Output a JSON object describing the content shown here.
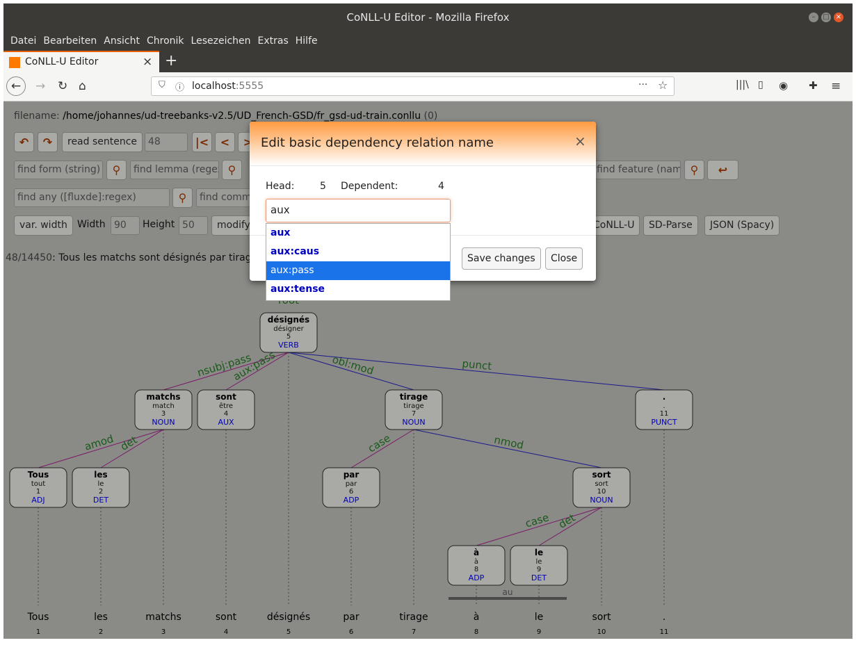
{
  "window": {
    "title": "CoNLL-U Editor - Mozilla Firefox"
  },
  "menu": [
    "Datei",
    "Bearbeiten",
    "Ansicht",
    "Chronik",
    "Lesezeichen",
    "Extras",
    "Hilfe"
  ],
  "tab": {
    "title": "CoNLL-U Editor",
    "favicon_text": "orange"
  },
  "url": {
    "host": "localhost",
    "port": ":5555"
  },
  "file": {
    "label": "filename:",
    "path": "/home/johannes/ud-treebanks-v2.5/UD_French-GSD/fr_gsd-ud-train.conllu",
    "suffix": "(0)"
  },
  "toolbar": {
    "read_sentence": "read sentence",
    "sentence_number": "48",
    "find_form": "find form (string)",
    "find_lemma": "find lemma (regex",
    "find_feature": "find feature (nam",
    "find_any": "find any ([fluxde]:regex)",
    "find_comment": "find comm",
    "var_width": "var. width",
    "width_label": "Width",
    "width_value": "90",
    "height_label": "Height",
    "height_value": "50",
    "modify": "modify",
    "conllu": "CoNLL-U",
    "sd_parse": "SD-Parse",
    "json": "JSON (Spacy)"
  },
  "sentence": {
    "counter": "48/14450",
    "text": ": Tous les matchs sont désignés par tirag"
  },
  "modal": {
    "title": "Edit basic dependency relation name",
    "close_x": "×",
    "head_label": "Head:",
    "head_value": "5",
    "dep_label": "Dependent:",
    "dep_value": "4",
    "input_value": "aux",
    "save": "Save changes",
    "close": "Close",
    "options": [
      "aux",
      "aux:caus",
      "aux:pass",
      "aux:tense"
    ],
    "selected_option": "aux:pass"
  },
  "tree": {
    "root_label": "root",
    "nodes": [
      {
        "id": "1",
        "form": "Tous",
        "lemma": "tout",
        "pos": "ADJ"
      },
      {
        "id": "2",
        "form": "les",
        "lemma": "le",
        "pos": "DET"
      },
      {
        "id": "3",
        "form": "matchs",
        "lemma": "match",
        "pos": "NOUN"
      },
      {
        "id": "4",
        "form": "sont",
        "lemma": "être",
        "pos": "AUX"
      },
      {
        "id": "5",
        "form": "désignés",
        "lemma": "désigner",
        "pos": "VERB"
      },
      {
        "id": "6",
        "form": "par",
        "lemma": "par",
        "pos": "ADP"
      },
      {
        "id": "7",
        "form": "tirage",
        "lemma": "tirage",
        "pos": "NOUN"
      },
      {
        "id": "8",
        "form": "à",
        "lemma": "à",
        "pos": "ADP"
      },
      {
        "id": "9",
        "form": "le",
        "lemma": "le",
        "pos": "DET"
      },
      {
        "id": "10",
        "form": "sort",
        "lemma": "sort",
        "pos": "NOUN"
      },
      {
        "id": "11",
        "form": ".",
        "lemma": ".",
        "pos": "PUNCT"
      }
    ],
    "edges": [
      {
        "head": "5",
        "dep": "3",
        "label": "nsubj:pass"
      },
      {
        "head": "5",
        "dep": "4",
        "label": "aux:pass"
      },
      {
        "head": "5",
        "dep": "7",
        "label": "obl:mod"
      },
      {
        "head": "5",
        "dep": "11",
        "label": "punct"
      },
      {
        "head": "3",
        "dep": "1",
        "label": "amod"
      },
      {
        "head": "3",
        "dep": "2",
        "label": "det"
      },
      {
        "head": "7",
        "dep": "6",
        "label": "case"
      },
      {
        "head": "7",
        "dep": "10",
        "label": "nmod"
      },
      {
        "head": "10",
        "dep": "8",
        "label": "case"
      },
      {
        "head": "10",
        "dep": "9",
        "label": "det"
      }
    ],
    "mwt_label": "au"
  },
  "colors": {
    "edge_blue": "#1a1a8c",
    "edge_purple": "#7a1a6a",
    "label_green": "#1a5a1a",
    "pos_blue": "#0000b0",
    "accent": "#e66000"
  }
}
